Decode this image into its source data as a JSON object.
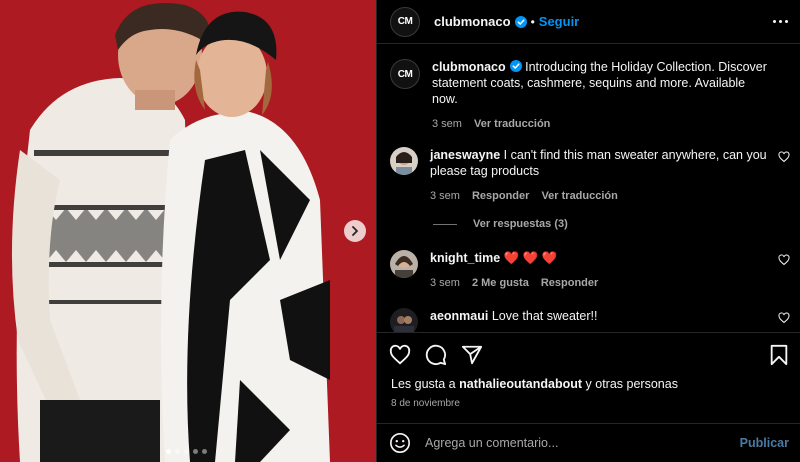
{
  "post": {
    "username": "clubmonaco",
    "avatar_text": "CM",
    "follow_label": "Seguir",
    "separator": "•",
    "caption": "Introducing the Holiday Collection. Discover statement coats, cashmere, sequins and more. Available now.",
    "caption_time": "3 sem",
    "caption_translate": "Ver traducción",
    "carousel": {
      "count": 5,
      "active": 0
    },
    "media_background": "#b51d24"
  },
  "comments": [
    {
      "username": "janeswayne",
      "text": "I can't find this man sweater anywhere, can you please tag products",
      "time": "3 sem",
      "reply_label": "Responder",
      "translate_label": "Ver traducción",
      "view_replies": "Ver respuestas (3)"
    },
    {
      "username": "knight_time",
      "text": "❤️ ❤️ ❤️",
      "time": "3 sem",
      "likes_label": "2 Me gusta",
      "reply_label": "Responder"
    },
    {
      "username": "aeonmaui",
      "text": "Love that sweater!!"
    }
  ],
  "likes": {
    "prefix": "Les gusta a",
    "user": "nathalieoutandabout",
    "suffix": "y otras personas"
  },
  "date": "8 de noviembre",
  "composer": {
    "placeholder": "Agrega un comentario...",
    "publish_label": "Publicar"
  },
  "colors": {
    "accent": "#0095f6",
    "verified": "#0095f6",
    "heart": "#ed4956",
    "publish_disabled": "#4b7aa3"
  },
  "icons": [
    "chevron-right-icon",
    "verified-badge-icon",
    "more-options-icon",
    "heart-icon",
    "comment-icon",
    "share-icon",
    "bookmark-icon",
    "emoji-icon"
  ]
}
